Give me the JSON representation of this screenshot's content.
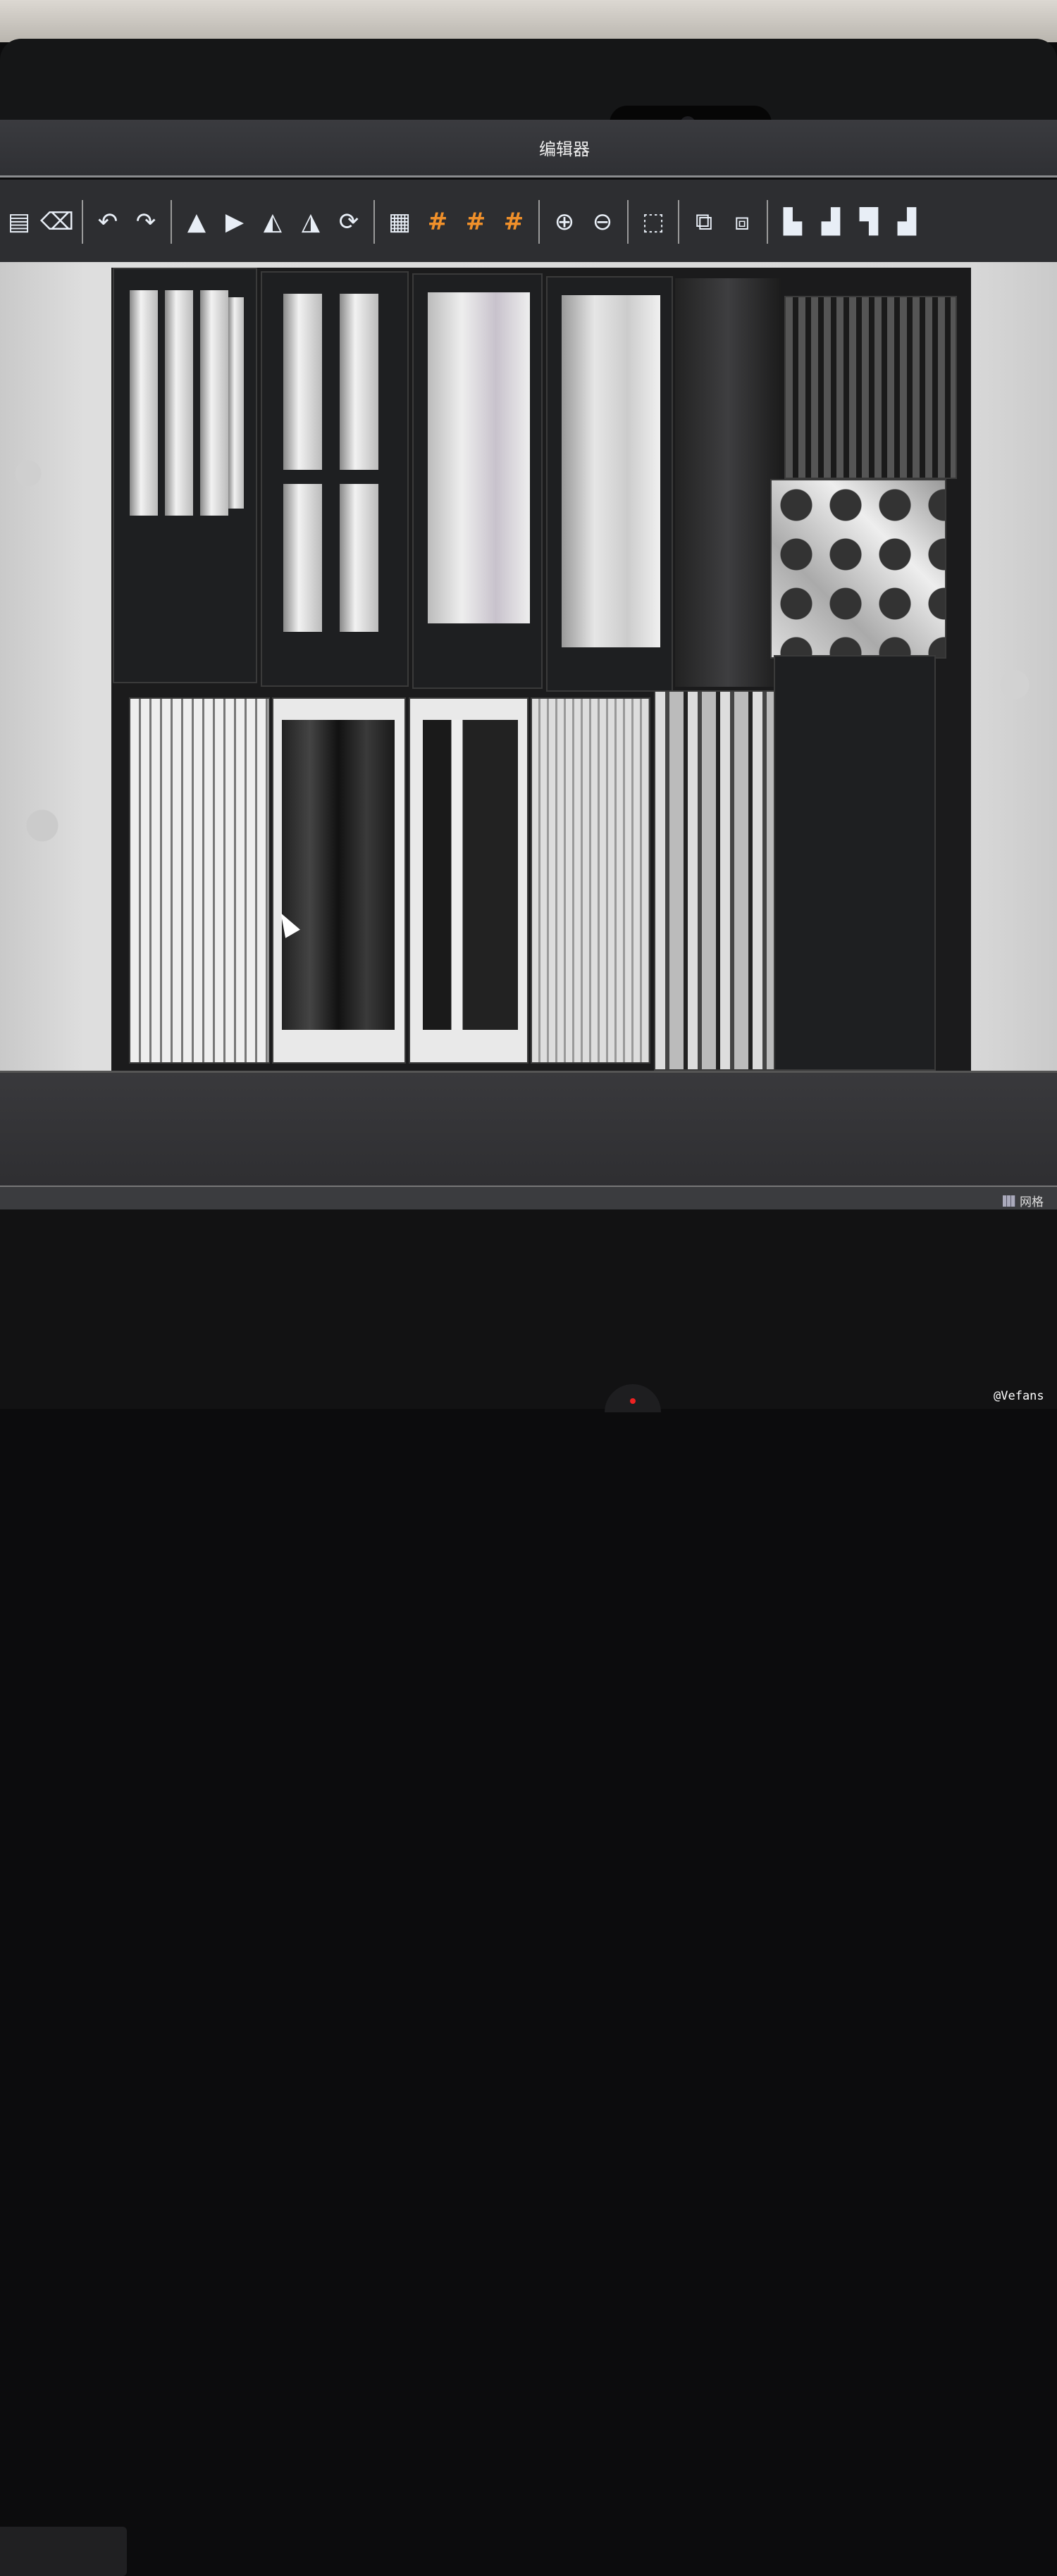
{
  "window": {
    "title": "编辑器"
  },
  "toolbar": {
    "items": [
      {
        "icon": "file-icon",
        "glyph": "▤"
      },
      {
        "icon": "clear-icon",
        "glyph": "⌫"
      },
      {
        "sep": true
      },
      {
        "icon": "undo-icon",
        "glyph": "↶"
      },
      {
        "icon": "redo-icon",
        "glyph": "↷"
      },
      {
        "sep": true
      },
      {
        "icon": "triangle-up-icon",
        "glyph": "▲"
      },
      {
        "icon": "triangle-right-icon",
        "glyph": "▶"
      },
      {
        "icon": "flip-left-icon",
        "glyph": "◭"
      },
      {
        "icon": "flip-right-icon",
        "glyph": "◮"
      },
      {
        "icon": "rotate-icon",
        "glyph": "⟳"
      },
      {
        "sep": true
      },
      {
        "icon": "grid-icon",
        "glyph": "▦"
      },
      {
        "icon": "snap-grid-icon",
        "glyph": "#",
        "color": "orange"
      },
      {
        "icon": "snap-grid-alt-icon",
        "glyph": "#",
        "color": "orange"
      },
      {
        "icon": "snap-grid-third-icon",
        "glyph": "#",
        "color": "orange"
      },
      {
        "sep": true
      },
      {
        "icon": "zoom-in-icon",
        "glyph": "⊕"
      },
      {
        "icon": "zoom-out-icon",
        "glyph": "⊖"
      },
      {
        "sep": true
      },
      {
        "icon": "select-region-icon",
        "glyph": "⬚"
      },
      {
        "sep": true
      },
      {
        "icon": "group-icon",
        "glyph": "⧉"
      },
      {
        "icon": "ungroup-icon",
        "glyph": "⧈"
      },
      {
        "sep": true
      },
      {
        "icon": "align-left-icon",
        "glyph": "▙"
      },
      {
        "icon": "align-bottom-icon",
        "glyph": "▟"
      },
      {
        "icon": "align-top-icon",
        "glyph": "▜"
      },
      {
        "icon": "align-right-icon",
        "glyph": "▟"
      }
    ]
  },
  "statusbar": {
    "grid_label": "网格"
  },
  "watermark": "@Vefans",
  "colors": {
    "accent_orange": "#f0902a",
    "toolbar_bg": "#2d2e31"
  }
}
